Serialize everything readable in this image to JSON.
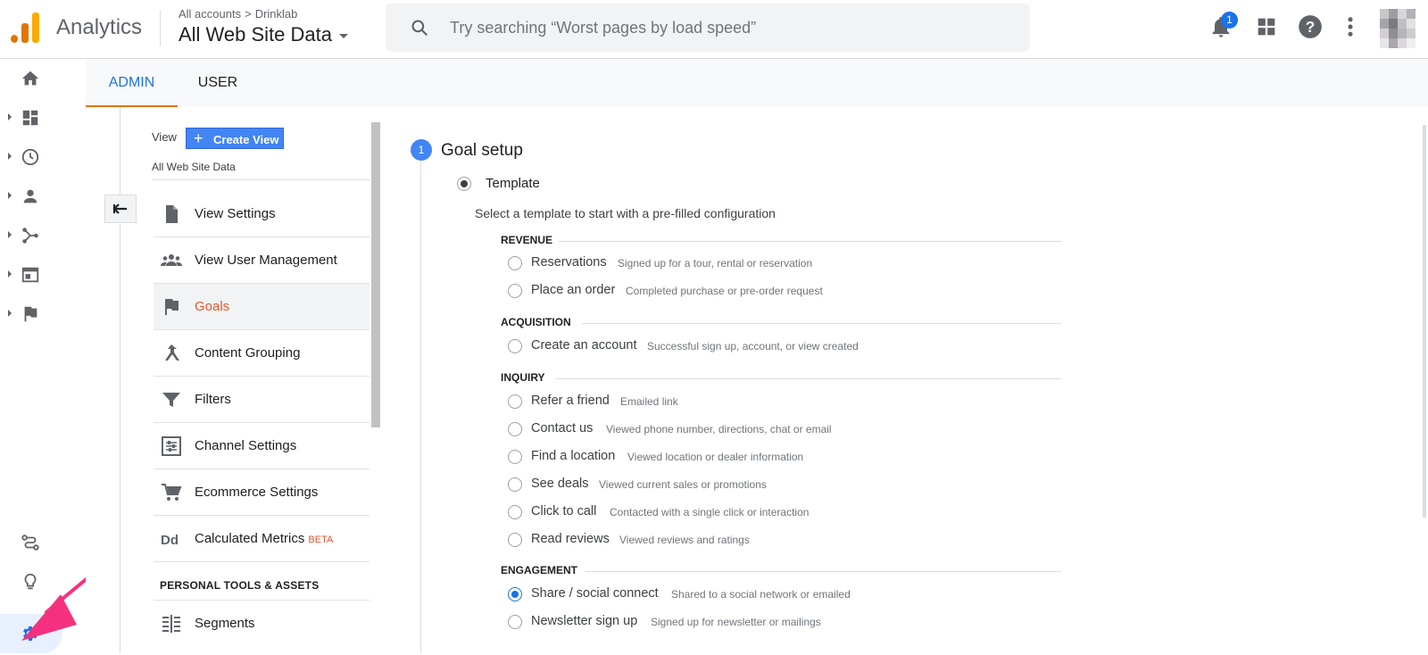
{
  "app": {
    "brand": "Analytics",
    "breadcrumb": {
      "account_label": "All accounts",
      "separator": ">",
      "account": "Drinklab"
    },
    "property": "All Web Site Data",
    "search_placeholder": "Try searching “Worst pages by load speed”",
    "notification_count": "1",
    "brand_colors": {
      "accent": "#1a73e8",
      "orange": "#f9ab00",
      "dark_orange": "#e37400",
      "highlight": "#e8562a"
    }
  },
  "rail": {
    "items": [
      {
        "icon": "home-icon"
      },
      {
        "icon": "dashboard-icon"
      },
      {
        "icon": "clock-icon"
      },
      {
        "icon": "person-icon"
      },
      {
        "icon": "acquisition-icon"
      },
      {
        "icon": "behavior-icon"
      },
      {
        "icon": "flag-icon"
      }
    ],
    "bottom": [
      {
        "icon": "attribution-icon"
      },
      {
        "icon": "lightbulb-icon"
      },
      {
        "icon": "gear-icon"
      }
    ]
  },
  "tabs": [
    {
      "label": "ADMIN",
      "active": true
    },
    {
      "label": "USER",
      "active": false
    }
  ],
  "view_column": {
    "label": "View",
    "create_button": "Create View",
    "view_name": "All Web Site Data",
    "menu": [
      {
        "label": "View Settings",
        "icon": "document-icon"
      },
      {
        "label": "View User Management",
        "icon": "people-icon"
      },
      {
        "label": "Goals",
        "icon": "flag-icon",
        "selected": true
      },
      {
        "label": "Content Grouping",
        "icon": "content-grouping-icon"
      },
      {
        "label": "Filters",
        "icon": "filter-icon"
      },
      {
        "label": "Channel Settings",
        "icon": "channel-settings-icon"
      },
      {
        "label": "Ecommerce Settings",
        "icon": "cart-icon"
      },
      {
        "label": "Calculated Metrics",
        "icon": "dd-icon",
        "badge": "BETA"
      }
    ],
    "section_heading": "PERSONAL TOOLS & ASSETS",
    "section_items": [
      {
        "label": "Segments",
        "icon": "segments-icon"
      }
    ]
  },
  "goal_setup": {
    "step_number": "1",
    "title": "Goal setup",
    "template_label": "Template",
    "template_desc": "Select a template to start with a pre-filled configuration",
    "categories": [
      {
        "name": "REVENUE",
        "options": [
          {
            "name": "Reservations",
            "desc": "Signed up for a tour, rental or reservation"
          },
          {
            "name": "Place an order",
            "desc": "Completed purchase or pre-order request"
          }
        ]
      },
      {
        "name": "ACQUISITION",
        "options": [
          {
            "name": "Create an account",
            "desc": "Successful sign up, account, or view created"
          }
        ]
      },
      {
        "name": "INQUIRY",
        "options": [
          {
            "name": "Refer a friend",
            "desc": "Emailed link"
          },
          {
            "name": "Contact us",
            "desc": "Viewed phone number, directions, chat or email"
          },
          {
            "name": "Find a location",
            "desc": "Viewed location or dealer information"
          },
          {
            "name": "See deals",
            "desc": "Viewed current sales or promotions"
          },
          {
            "name": "Click to call",
            "desc": "Contacted with a single click or interaction"
          },
          {
            "name": "Read reviews",
            "desc": "Viewed reviews and ratings"
          }
        ]
      },
      {
        "name": "ENGAGEMENT",
        "options": [
          {
            "name": "Share / social connect",
            "desc": "Shared to a social network or emailed",
            "selected": true
          },
          {
            "name": "Newsletter sign up",
            "desc": "Signed up for newsletter or mailings"
          }
        ]
      }
    ]
  }
}
